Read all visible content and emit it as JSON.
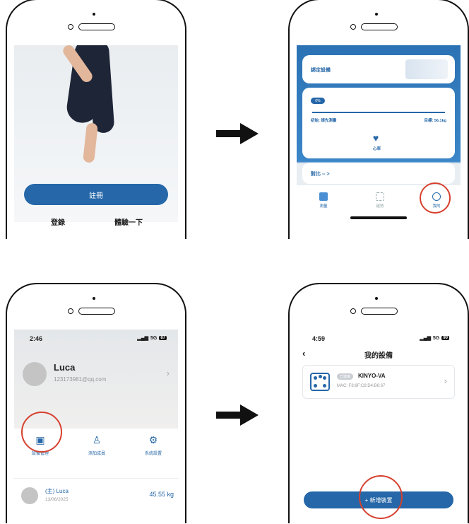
{
  "step1": {
    "register_label": "註冊",
    "login_label": "登錄",
    "try_label": "體驗一下"
  },
  "step2": {
    "bind_device_label": "綁定設備",
    "progress_pct": "0%",
    "start_label": "初始: 請先測量",
    "target_label": "目標: 56.1kg",
    "heart_label": "心率",
    "compare_label": "對比 -- >",
    "tabs": [
      "測量",
      "趨勢",
      "我的"
    ]
  },
  "step3": {
    "time": "2:46",
    "signal": "5G",
    "battery": "87",
    "user_name": "Luca",
    "user_email": "123173981@qq.com",
    "grid": [
      "設備管理",
      "添加成員",
      "系統設置"
    ],
    "member_tag": "(主)",
    "member_name": "Luca",
    "member_date": "13/06/2025",
    "member_weight": "45.55 kg"
  },
  "step4": {
    "time": "4:59",
    "signal": "5G",
    "battery": "90",
    "title": "我的設備",
    "conn_badge": "已連接",
    "device_name": "KINYO-VA",
    "mac": "MAC: F8:8F:C8:D4:B6:67",
    "add_label": "+ 新增裝置"
  },
  "colors": {
    "primary": "#2567a8",
    "highlight": "#d6402e"
  }
}
